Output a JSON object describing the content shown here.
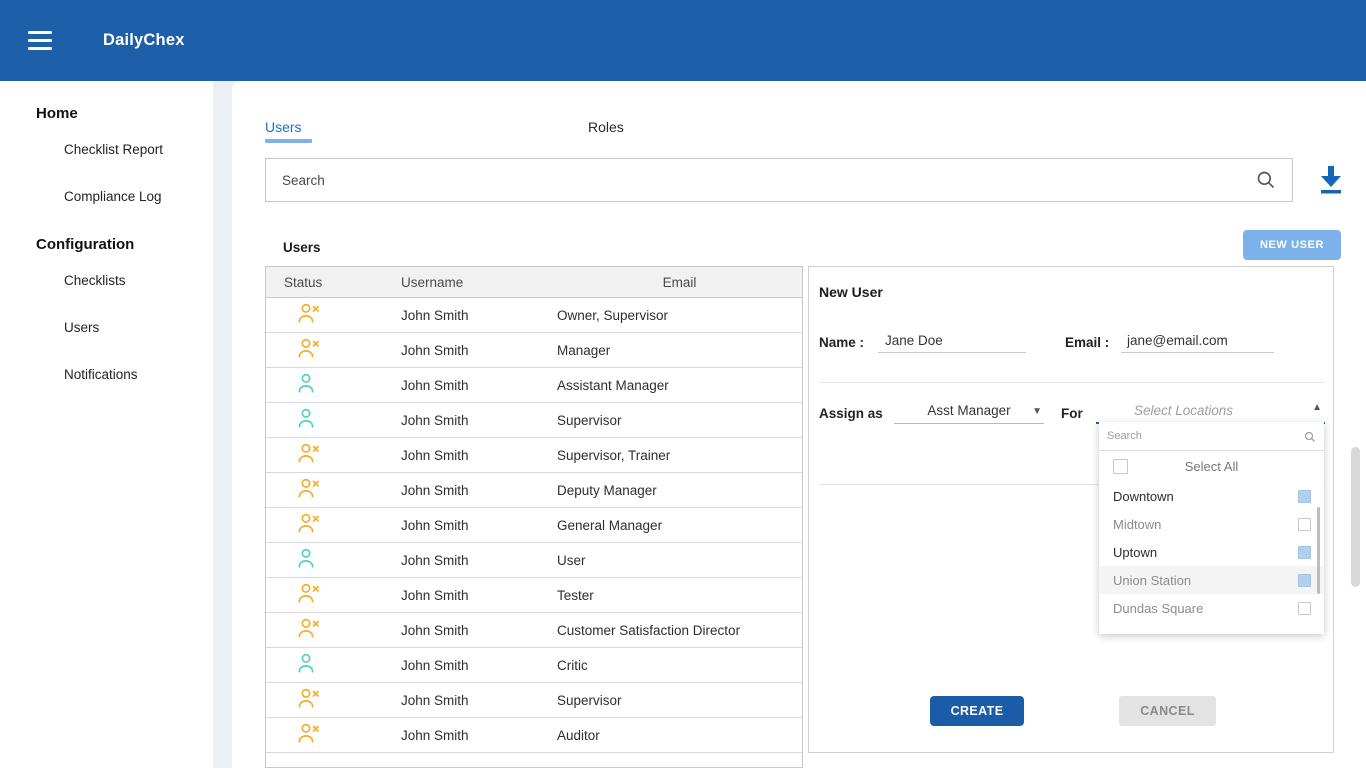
{
  "header": {
    "title": "DailyChex"
  },
  "sidebar": {
    "sections": [
      {
        "label": "Home",
        "items": [
          {
            "label": "Checklist Report"
          },
          {
            "label": "Compliance Log"
          }
        ]
      },
      {
        "label": "Configuration",
        "items": [
          {
            "label": "Checklists"
          },
          {
            "label": "Users"
          },
          {
            "label": "Notifications"
          }
        ]
      }
    ]
  },
  "tabs": [
    {
      "label": "Users",
      "active": true
    },
    {
      "label": "Roles",
      "active": false
    }
  ],
  "search": {
    "placeholder": "Search"
  },
  "users_section": {
    "title": "Users",
    "new_user_button": "NEW USER"
  },
  "table": {
    "columns": [
      "Status",
      "Username",
      "Email"
    ],
    "rows": [
      {
        "status": "inactive",
        "username": "John Smith",
        "email": "Owner, Supervisor"
      },
      {
        "status": "inactive",
        "username": "John Smith",
        "email": "Manager"
      },
      {
        "status": "active",
        "username": "John Smith",
        "email": "Assistant Manager"
      },
      {
        "status": "active",
        "username": "John Smith",
        "email": "Supervisor"
      },
      {
        "status": "inactive",
        "username": "John Smith",
        "email": "Supervisor, Trainer"
      },
      {
        "status": "inactive",
        "username": "John Smith",
        "email": "Deputy Manager"
      },
      {
        "status": "inactive",
        "username": "John Smith",
        "email": "General Manager"
      },
      {
        "status": "active",
        "username": "John Smith",
        "email": "User"
      },
      {
        "status": "inactive",
        "username": "John Smith",
        "email": "Tester"
      },
      {
        "status": "inactive",
        "username": "John Smith",
        "email": "Customer Satisfaction Director"
      },
      {
        "status": "active",
        "username": "John Smith",
        "email": "Critic"
      },
      {
        "status": "inactive",
        "username": "John Smith",
        "email": "Supervisor"
      },
      {
        "status": "inactive",
        "username": "John Smith",
        "email": "Auditor"
      }
    ]
  },
  "new_user_form": {
    "title": "New User",
    "name_label": "Name :",
    "name_value": "Jane Doe",
    "email_label": "Email :",
    "email_value": "jane@email.com",
    "assign_as_label": "Assign as",
    "assign_as_value": "Asst Manager",
    "for_label": "For",
    "locations_placeholder": "Select Locations",
    "create_button": "CREATE",
    "cancel_button": "CANCEL"
  },
  "locations_dropdown": {
    "search_placeholder": "Search",
    "select_all_label": "Select All",
    "select_all_checked": false,
    "options": [
      {
        "label": "Downtown",
        "checked": true,
        "emphasized": true,
        "highlighted": false
      },
      {
        "label": "Midtown",
        "checked": false,
        "emphasized": false,
        "highlighted": false
      },
      {
        "label": "Uptown",
        "checked": true,
        "emphasized": true,
        "highlighted": false
      },
      {
        "label": "Union Station",
        "checked": true,
        "emphasized": false,
        "highlighted": true
      },
      {
        "label": "Dundas Square",
        "checked": false,
        "emphasized": false,
        "highlighted": false
      }
    ]
  },
  "colors": {
    "header_blue": "#1e5fa9",
    "active_tab_blue": "#1b6fd0",
    "tab_underline": "#7fb0e8",
    "download_blue": "#1565b8",
    "new_user_button_bg": "#7cb1ea",
    "create_button_bg": "#1b5ca8",
    "active_icon": "#4fd0c4",
    "inactive_icon": "#f2ae2c",
    "checked_checkbox": "#b3cfec"
  }
}
